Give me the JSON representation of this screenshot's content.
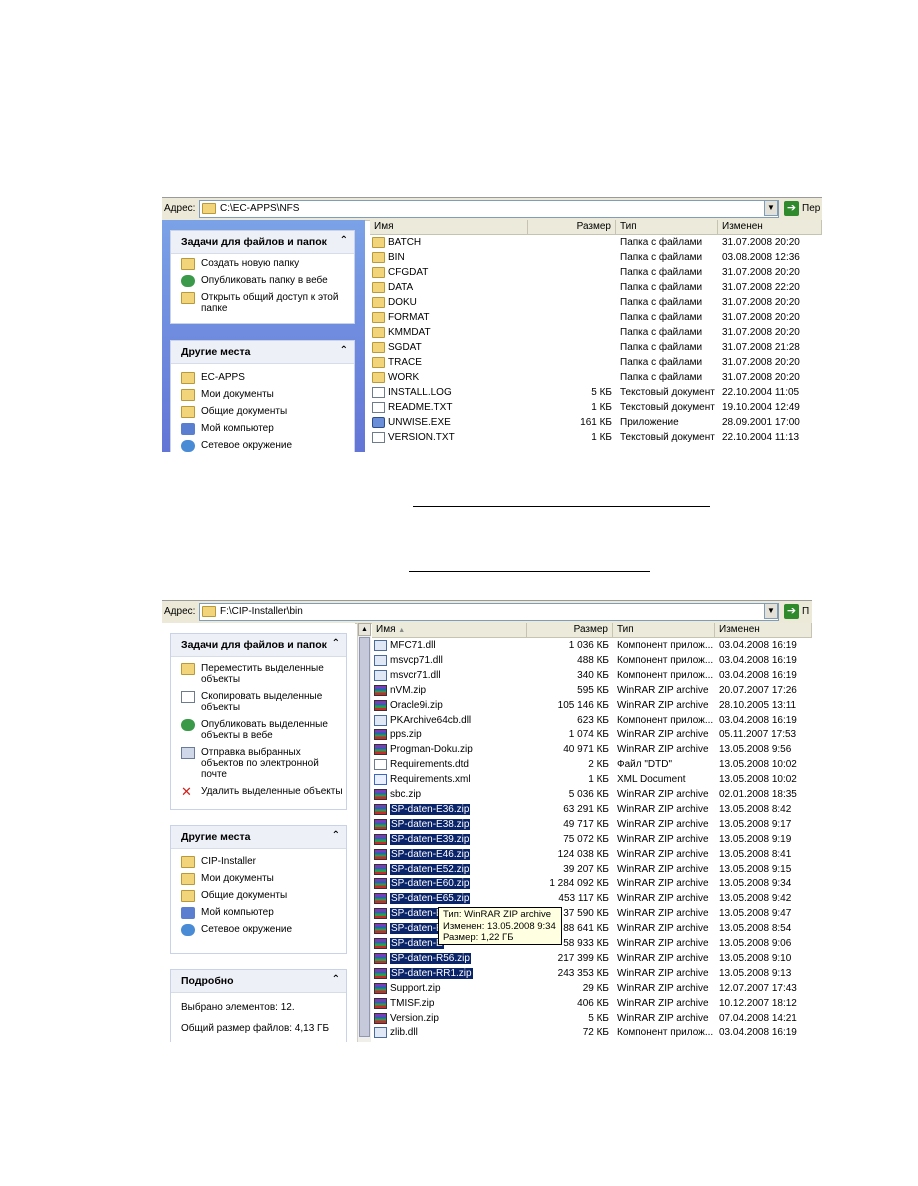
{
  "screenshot1": {
    "address_label": "Адрес:",
    "address_path": "C:\\EC-APPS\\NFS",
    "go_label": "Пер",
    "tasks_panel": {
      "title": "Задачи для файлов и папок",
      "items": [
        {
          "label": "Создать новую папку",
          "icon": "new-folder-icon"
        },
        {
          "label": "Опубликовать папку в вебе",
          "icon": "web-publish-icon"
        },
        {
          "label": "Открыть общий доступ к этой папке",
          "icon": "share-folder-icon"
        }
      ]
    },
    "places_panel": {
      "title": "Другие места",
      "items": [
        {
          "label": "EC-APPS",
          "icon": "folder-icon"
        },
        {
          "label": "Мои документы",
          "icon": "my-documents-icon"
        },
        {
          "label": "Общие документы",
          "icon": "shared-documents-icon"
        },
        {
          "label": "Мой компьютер",
          "icon": "my-computer-icon"
        },
        {
          "label": "Сетевое окружение",
          "icon": "network-icon"
        }
      ]
    },
    "columns": {
      "name": "Имя",
      "size": "Размер",
      "type": "Тип",
      "modified": "Изменен"
    },
    "files": [
      {
        "name": "BATCH",
        "size": "",
        "type": "Папка с файлами",
        "modified": "31.07.2008 20:20",
        "icon": "folder"
      },
      {
        "name": "BIN",
        "size": "",
        "type": "Папка с файлами",
        "modified": "03.08.2008 12:36",
        "icon": "folder"
      },
      {
        "name": "CFGDAT",
        "size": "",
        "type": "Папка с файлами",
        "modified": "31.07.2008 20:20",
        "icon": "folder"
      },
      {
        "name": "DATA",
        "size": "",
        "type": "Папка с файлами",
        "modified": "31.07.2008 22:20",
        "icon": "folder"
      },
      {
        "name": "DOKU",
        "size": "",
        "type": "Папка с файлами",
        "modified": "31.07.2008 20:20",
        "icon": "folder"
      },
      {
        "name": "FORMAT",
        "size": "",
        "type": "Папка с файлами",
        "modified": "31.07.2008 20:20",
        "icon": "folder"
      },
      {
        "name": "KMMDAT",
        "size": "",
        "type": "Папка с файлами",
        "modified": "31.07.2008 20:20",
        "icon": "folder"
      },
      {
        "name": "SGDAT",
        "size": "",
        "type": "Папка с файлами",
        "modified": "31.07.2008 21:28",
        "icon": "folder"
      },
      {
        "name": "TRACE",
        "size": "",
        "type": "Папка с файлами",
        "modified": "31.07.2008 20:20",
        "icon": "folder"
      },
      {
        "name": "WORK",
        "size": "",
        "type": "Папка с файлами",
        "modified": "31.07.2008 20:20",
        "icon": "folder"
      },
      {
        "name": "INSTALL.LOG",
        "size": "5 КБ",
        "type": "Текстовый документ",
        "modified": "22.10.2004 11:05",
        "icon": "doc"
      },
      {
        "name": "README.TXT",
        "size": "1 КБ",
        "type": "Текстовый документ",
        "modified": "19.10.2004 12:49",
        "icon": "doc"
      },
      {
        "name": "UNWISE.EXE",
        "size": "161 КБ",
        "type": "Приложение",
        "modified": "28.09.2001 17:00",
        "icon": "exe"
      },
      {
        "name": "VERSION.TXT",
        "size": "1 КБ",
        "type": "Текстовый документ",
        "modified": "22.10.2004 11:13",
        "icon": "doc"
      }
    ]
  },
  "screenshot2": {
    "address_label": "Адрес:",
    "address_path": "F:\\CIP-Installer\\bin",
    "go_label": "П",
    "tasks_panel": {
      "title": "Задачи для файлов и папок",
      "items": [
        {
          "label": "Переместить выделенные объекты",
          "icon": "move-icon"
        },
        {
          "label": "Скопировать выделенные объекты",
          "icon": "copy-icon"
        },
        {
          "label": "Опубликовать выделенные объекты в вебе",
          "icon": "web-publish-icon"
        },
        {
          "label": "Отправка выбранных объектов по электронной почте",
          "icon": "email-icon"
        },
        {
          "label": "Удалить выделенные объекты",
          "icon": "delete-icon"
        }
      ]
    },
    "places_panel": {
      "title": "Другие места",
      "items": [
        {
          "label": "CIP-Installer",
          "icon": "folder-icon"
        },
        {
          "label": "Мои документы",
          "icon": "my-documents-icon"
        },
        {
          "label": "Общие документы",
          "icon": "shared-documents-icon"
        },
        {
          "label": "Мой компьютер",
          "icon": "my-computer-icon"
        },
        {
          "label": "Сетевое окружение",
          "icon": "network-icon"
        }
      ]
    },
    "details_panel": {
      "title": "Подробно",
      "selected": "Выбрано элементов: 12.",
      "total_size": "Общий размер файлов: 4,13 ГБ"
    },
    "columns": {
      "name": "Имя",
      "size": "Размер",
      "type": "Тип",
      "modified": "Изменен"
    },
    "files": [
      {
        "name": "MFC71.dll",
        "size": "1 036 КБ",
        "type": "Компонент прилож...",
        "modified": "03.04.2008 16:19",
        "icon": "dll",
        "selected": false
      },
      {
        "name": "msvcp71.dll",
        "size": "488 КБ",
        "type": "Компонент прилож...",
        "modified": "03.04.2008 16:19",
        "icon": "dll",
        "selected": false
      },
      {
        "name": "msvcr71.dll",
        "size": "340 КБ",
        "type": "Компонент прилож...",
        "modified": "03.04.2008 16:19",
        "icon": "dll",
        "selected": false
      },
      {
        "name": "nVM.zip",
        "size": "595 КБ",
        "type": "WinRAR ZIP archive",
        "modified": "20.07.2007 17:26",
        "icon": "zip",
        "selected": false
      },
      {
        "name": "Oracle9i.zip",
        "size": "105 146 КБ",
        "type": "WinRAR ZIP archive",
        "modified": "28.10.2005 13:11",
        "icon": "zip",
        "selected": false
      },
      {
        "name": "PKArchive64cb.dll",
        "size": "623 КБ",
        "type": "Компонент прилож...",
        "modified": "03.04.2008 16:19",
        "icon": "dll",
        "selected": false
      },
      {
        "name": "pps.zip",
        "size": "1 074 КБ",
        "type": "WinRAR ZIP archive",
        "modified": "05.11.2007 17:53",
        "icon": "zip",
        "selected": false
      },
      {
        "name": "Progman-Doku.zip",
        "size": "40 971 КБ",
        "type": "WinRAR ZIP archive",
        "modified": "13.05.2008 9:56",
        "icon": "zip",
        "selected": false
      },
      {
        "name": "Requirements.dtd",
        "size": "2 КБ",
        "type": "Файл \"DTD\"",
        "modified": "13.05.2008 10:02",
        "icon": "doc",
        "selected": false
      },
      {
        "name": "Requirements.xml",
        "size": "1 КБ",
        "type": "XML Document",
        "modified": "13.05.2008 10:02",
        "icon": "xml",
        "selected": false
      },
      {
        "name": "sbc.zip",
        "size": "5 036 КБ",
        "type": "WinRAR ZIP archive",
        "modified": "02.01.2008 18:35",
        "icon": "zip",
        "selected": false
      },
      {
        "name": "SP-daten-E36.zip",
        "size": "63 291 КБ",
        "type": "WinRAR ZIP archive",
        "modified": "13.05.2008 8:42",
        "icon": "zip",
        "selected": true
      },
      {
        "name": "SP-daten-E38.zip",
        "size": "49 717 КБ",
        "type": "WinRAR ZIP archive",
        "modified": "13.05.2008 9:17",
        "icon": "zip",
        "selected": true
      },
      {
        "name": "SP-daten-E39.zip",
        "size": "75 072 КБ",
        "type": "WinRAR ZIP archive",
        "modified": "13.05.2008 9:19",
        "icon": "zip",
        "selected": true
      },
      {
        "name": "SP-daten-E46.zip",
        "size": "124 038 КБ",
        "type": "WinRAR ZIP archive",
        "modified": "13.05.2008 8:41",
        "icon": "zip",
        "selected": true
      },
      {
        "name": "SP-daten-E52.zip",
        "size": "39 207 КБ",
        "type": "WinRAR ZIP archive",
        "modified": "13.05.2008 9:15",
        "icon": "zip",
        "selected": true
      },
      {
        "name": "SP-daten-E60.zip",
        "size": "1 284 092 КБ",
        "type": "WinRAR ZIP archive",
        "modified": "13.05.2008 9:34",
        "icon": "zip",
        "selected": true
      },
      {
        "name": "SP-daten-E65.zip",
        "size": "453 117 КБ",
        "type": "WinRAR ZIP archive",
        "modified": "13.05.2008 9:42",
        "icon": "zip",
        "selected": true
      },
      {
        "name": "SP-daten-E",
        "size": "37 590 КБ",
        "type": "WinRAR ZIP archive",
        "modified": "13.05.2008 9:47",
        "icon": "zip",
        "selected": true
      },
      {
        "name": "SP-daten-E",
        "size": "88 641 КБ",
        "type": "WinRAR ZIP archive",
        "modified": "13.05.2008 8:54",
        "icon": "zip",
        "selected": true
      },
      {
        "name": "SP-daten-E",
        "size": "58 933 КБ",
        "type": "WinRAR ZIP archive",
        "modified": "13.05.2008 9:06",
        "icon": "zip",
        "selected": true
      },
      {
        "name": "SP-daten-R56.zip",
        "size": "217 399 КБ",
        "type": "WinRAR ZIP archive",
        "modified": "13.05.2008 9:10",
        "icon": "zip",
        "selected": true
      },
      {
        "name": "SP-daten-RR1.zip",
        "size": "243 353 КБ",
        "type": "WinRAR ZIP archive",
        "modified": "13.05.2008 9:13",
        "icon": "zip",
        "selected": true
      },
      {
        "name": "Support.zip",
        "size": "29 КБ",
        "type": "WinRAR ZIP archive",
        "modified": "12.07.2007 17:43",
        "icon": "zip",
        "selected": false
      },
      {
        "name": "TMISF.zip",
        "size": "406 КБ",
        "type": "WinRAR ZIP archive",
        "modified": "10.12.2007 18:12",
        "icon": "zip",
        "selected": false
      },
      {
        "name": "Version.zip",
        "size": "5 КБ",
        "type": "WinRAR ZIP archive",
        "modified": "07.04.2008 14:21",
        "icon": "zip",
        "selected": false
      },
      {
        "name": "zlib.dll",
        "size": "72 КБ",
        "type": "Компонент прилож...",
        "modified": "03.04.2008 16:19",
        "icon": "dll",
        "selected": false
      }
    ],
    "tooltip": {
      "line1": "Тип: WinRAR ZIP archive",
      "line2": "Изменен: 13.05.2008 9:34",
      "line3": "Размер: 1,22 ГБ"
    }
  },
  "colors": {
    "selection": "#0a246a",
    "tooltip_bg": "#ffffe1",
    "xp_panel_gradient": "#6375d6",
    "go_button": "#2e8a2a"
  }
}
